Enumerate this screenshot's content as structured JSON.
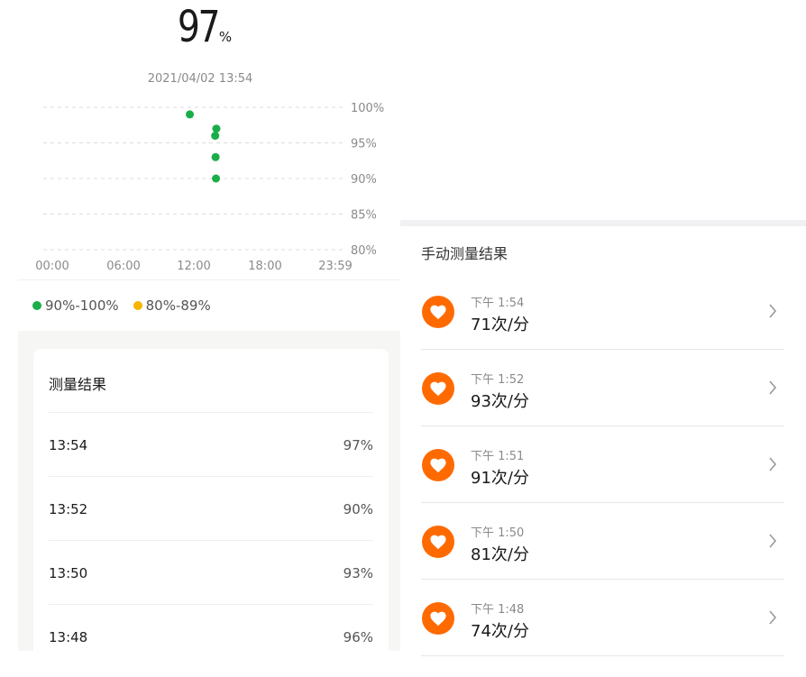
{
  "left": {
    "reading": {
      "value": "97",
      "unit": "%",
      "timestamp": "2021/04/02 13:54"
    },
    "legend": [
      {
        "label": "90%-100%",
        "color": "#1aad4a"
      },
      {
        "label": "80%-89%",
        "color": "#f7b500"
      }
    ],
    "results": {
      "title": "测量结果",
      "rows": [
        {
          "time": "13:54",
          "value": "97%"
        },
        {
          "time": "13:52",
          "value": "90%"
        },
        {
          "time": "13:50",
          "value": "93%"
        },
        {
          "time": "13:48",
          "value": "96%"
        }
      ]
    }
  },
  "chart_data": {
    "type": "scatter",
    "x_ticks": [
      "00:00",
      "06:00",
      "12:00",
      "18:00",
      "23:59"
    ],
    "y_ticks": [
      "100%",
      "95%",
      "90%",
      "85%",
      "80%"
    ],
    "ylim": [
      80,
      100
    ],
    "xlim_minutes": [
      0,
      1439
    ],
    "grid": true,
    "points": [
      {
        "time": "11:39",
        "minutes": 699,
        "value": 99
      },
      {
        "time": "13:48",
        "minutes": 828,
        "value": 96
      },
      {
        "time": "13:50",
        "minutes": 830,
        "value": 93
      },
      {
        "time": "13:52",
        "minutes": 832,
        "value": 90
      },
      {
        "time": "13:54",
        "minutes": 834,
        "value": 97
      }
    ],
    "point_color": "#1aad4a"
  },
  "right": {
    "title": "手动测量结果",
    "accent": "#ff6a00",
    "items": [
      {
        "time": "下午 1:54",
        "value": "71次/分"
      },
      {
        "time": "下午 1:52",
        "value": "93次/分"
      },
      {
        "time": "下午 1:51",
        "value": "91次/分"
      },
      {
        "time": "下午 1:50",
        "value": "81次/分"
      },
      {
        "time": "下午 1:48",
        "value": "74次/分"
      }
    ],
    "icon": "heart-icon"
  }
}
